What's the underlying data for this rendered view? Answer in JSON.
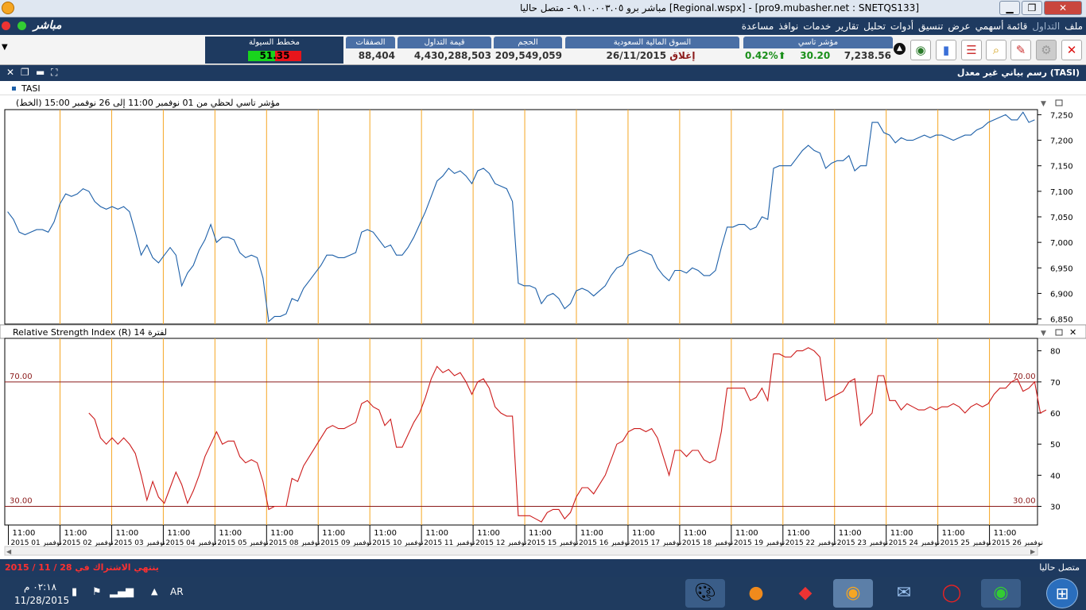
{
  "window": {
    "title": "مباشر برو ٩.١٠.٠٠٣.٠٥ - متصل حاليا [Regional.wspx] - [pro9.mubasher.net : SNETQS133]"
  },
  "app": {
    "logo": "مباشر"
  },
  "menu": {
    "items": [
      "ملف",
      "التداول",
      "قائمة أسهمي",
      "عرض",
      "تنسيق",
      "أدوات",
      "تحليل",
      "تقارير",
      "خدمات",
      "نوافذ",
      "مساعدة"
    ]
  },
  "quote": {
    "tasi_label": "مؤشر تاسي",
    "tasi_value": "7,238.56",
    "tasi_change": "30.20",
    "tasi_pct": "0.42%",
    "market_label": "السوق المالية السعودية",
    "market_date": "26/11/2015",
    "market_state": "إغلاق",
    "volume_label": "الحجم",
    "volume": "209,549,059",
    "turnover_label": "قيمة التداول",
    "turnover": "4,430,288,503",
    "trades_label": "الصفقات",
    "trades": "88,404",
    "liquidity_label": "مخطط السيولة",
    "liquidity_value": "51.35",
    "liquidity_fraction": 0.5135,
    "colors": {
      "up": "#1a8f1a",
      "down": "#e8151b",
      "header": "#4a6fa5"
    }
  },
  "toolbar": {
    "icons": [
      "close-icon",
      "unknown-icon",
      "chart-icon",
      "search-icon",
      "list-icon",
      "bar-chart-icon",
      "globe-icon",
      "stop-icon"
    ]
  },
  "panel": {
    "title": "رسم بياني غير معدل (TASI)"
  },
  "legend": {
    "symbol": "TASI"
  },
  "statusbar": {
    "left_text": "2015 / 11 / 28 ينتهي الاشتراك في",
    "right_text": "متصل حاليا"
  },
  "taskbar": {
    "time": "٠٢:١٨ م",
    "date": "11/28/2015",
    "lang": "AR"
  },
  "chart_data": [
    {
      "type": "line",
      "title": "مؤشر تاسي لحظي  من 01 نوفمبر 11:00 إلى 26 نوفمبر 15:00 (الخط)",
      "series": [
        {
          "values": [
            7060,
            7045,
            7020,
            7015,
            7020,
            7025,
            7025,
            7020,
            7040,
            7075,
            7095,
            7090,
            7095,
            7105,
            7100,
            7080,
            7070,
            7065,
            7070,
            7065,
            7070,
            7060,
            7020,
            6975,
            6995,
            6970,
            6960,
            6975,
            6990,
            6975,
            6915,
            6940,
            6955,
            6985,
            7005,
            7035,
            7000,
            7010,
            7010,
            7005,
            6980,
            6970,
            6975,
            6970,
            6930,
            6845,
            6855,
            6855,
            6860,
            6890,
            6885,
            6910,
            6925,
            6940,
            6955,
            6975,
            6975,
            6970,
            6970,
            6975,
            6980,
            7020,
            7025,
            7020,
            7005,
            6990,
            6995,
            6975,
            6975,
            6990,
            7010,
            7035,
            7060,
            7090,
            7120,
            7130,
            7145,
            7135,
            7140,
            7130,
            7115,
            7140,
            7145,
            7135,
            7115,
            7110,
            7105,
            7080,
            6920,
            6915,
            6915,
            6910,
            6880,
            6895,
            6900,
            6890,
            6870,
            6880,
            6905,
            6910,
            6905,
            6895,
            6905,
            6915,
            6935,
            6950,
            6955,
            6975,
            6980,
            6985,
            6980,
            6975,
            6950,
            6935,
            6925,
            6945,
            6945,
            6940,
            6950,
            6945,
            6935,
            6935,
            6945,
            6990,
            7030,
            7030,
            7035,
            7035,
            7025,
            7030,
            7050,
            7045,
            7145,
            7150,
            7150,
            7150,
            7165,
            7180,
            7190,
            7180,
            7175,
            7145,
            7155,
            7160,
            7160,
            7170,
            7140,
            7150,
            7150,
            7235,
            7235,
            7215,
            7210,
            7195,
            7205,
            7200,
            7200,
            7205,
            7210,
            7205,
            7210,
            7210,
            7205,
            7200,
            7205,
            7210,
            7210,
            7220,
            7225,
            7235,
            7240,
            7245,
            7250,
            7240,
            7240,
            7255,
            7235,
            7240
          ]
        }
      ],
      "ylim": [
        6840,
        7260
      ],
      "yticks": [
        6850,
        6900,
        6950,
        7000,
        7050,
        7100,
        7150,
        7200,
        7250
      ],
      "xticks": [
        [
          "11:00",
          "2015 نوفمبر 01"
        ],
        [
          "11:00",
          "2015 نوفمبر 02"
        ],
        [
          "11:00",
          "2015 نوفمبر 03"
        ],
        [
          "11:00",
          "2015 نوفمبر 04"
        ],
        [
          "11:00",
          "2015 نوفمبر 05"
        ],
        [
          "11:00",
          "2015 نوفمبر 08"
        ],
        [
          "11:00",
          "2015 نوفمبر 09"
        ],
        [
          "11:00",
          "2015 نوفمبر 10"
        ],
        [
          "11:00",
          "2015 نوفمبر 11"
        ],
        [
          "11:00",
          "2015 نوفمبر 12"
        ],
        [
          "11:00",
          "2015 نوفمبر 15"
        ],
        [
          "11:00",
          "2015 نوفمبر 16"
        ],
        [
          "11:00",
          "2015 نوفمبر 17"
        ],
        [
          "11:00",
          "2015 نوفمبر 18"
        ],
        [
          "11:00",
          "2015 نوفمبر 19"
        ],
        [
          "11:00",
          "2015 نوفمبر 22"
        ],
        [
          "11:00",
          "2015 نوفمبر 23"
        ],
        [
          "11:00",
          "2015 نوفمبر 24"
        ],
        [
          "11:00",
          "2015 نوفمبر 25"
        ],
        [
          "11:00",
          "2015 نوفمبر 26"
        ]
      ],
      "grid": "vertical day separators",
      "colors": {
        "line": "#1c5fa8",
        "day": "#f5a623"
      }
    },
    {
      "type": "line",
      "title": "Relative Strength Index (R) 14 لفترة",
      "series": [
        {
          "values": [
            null,
            null,
            null,
            null,
            null,
            null,
            null,
            null,
            null,
            null,
            null,
            null,
            null,
            null,
            60,
            58,
            52,
            50,
            52,
            50,
            52,
            50,
            47,
            40,
            32,
            38,
            33,
            31,
            36,
            41,
            37,
            31,
            35,
            40,
            46,
            50,
            54,
            50,
            51,
            51,
            46,
            44,
            45,
            44,
            38,
            29,
            30,
            30,
            30,
            39,
            38,
            43,
            46,
            49,
            52,
            55,
            56,
            55,
            55,
            56,
            57,
            63,
            64,
            62,
            61,
            56,
            58,
            49,
            49,
            53,
            57,
            60,
            65,
            71,
            75,
            73,
            74,
            72,
            73,
            70,
            66,
            70,
            71,
            68,
            62,
            60,
            59,
            59,
            27,
            27,
            27,
            26,
            25,
            28,
            29,
            29,
            26,
            28,
            33,
            36,
            36,
            34,
            37,
            40,
            45,
            50,
            51,
            54,
            55,
            55,
            54,
            55,
            52,
            46,
            40,
            48,
            48,
            46,
            48,
            48,
            45,
            44,
            45,
            54,
            68,
            68,
            68,
            68,
            64,
            65,
            68,
            64,
            79,
            79,
            78,
            78,
            80,
            80,
            81,
            80,
            78,
            64,
            65,
            66,
            67,
            70,
            71,
            56,
            58,
            60,
            72,
            72,
            64,
            64,
            61,
            63,
            62,
            61,
            61,
            62,
            61,
            62,
            62,
            63,
            62,
            60,
            62,
            63,
            62,
            63,
            66,
            68,
            68,
            70,
            71,
            67,
            68,
            70,
            60,
            61
          ]
        }
      ],
      "ylim": [
        24,
        84
      ],
      "yticks": [
        30,
        40,
        50,
        60,
        70,
        80
      ],
      "levels": [
        "70.00",
        "30.00"
      ],
      "colors": {
        "line": "#cc1a1a",
        "level": "#8b1a1a"
      }
    }
  ]
}
